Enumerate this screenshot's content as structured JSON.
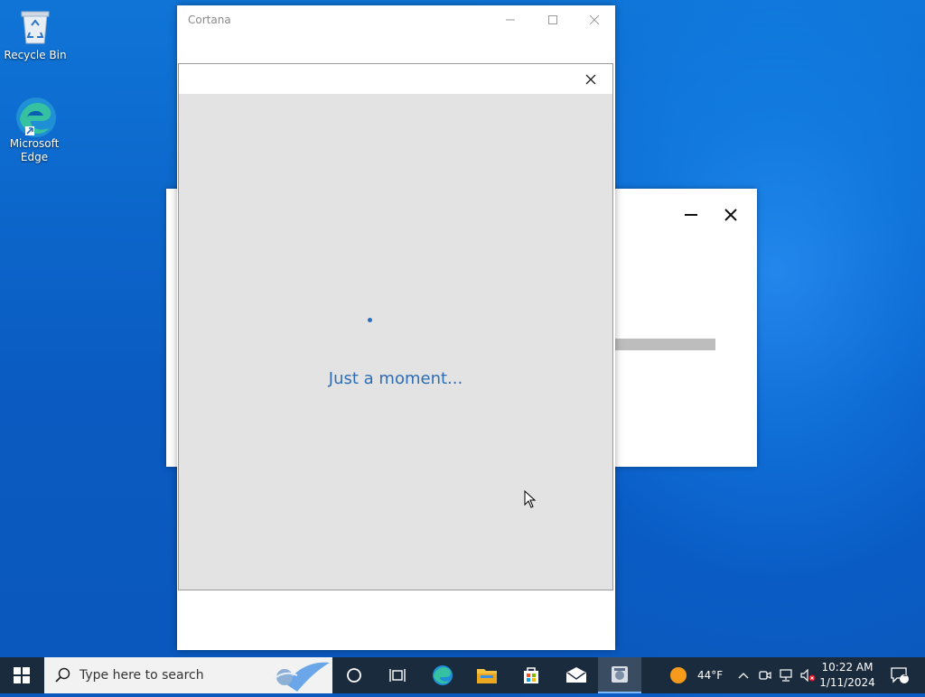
{
  "desktop": {
    "icons": [
      {
        "label": "Recycle Bin",
        "icon": "recycle-bin-icon"
      },
      {
        "label": "Microsoft Edge",
        "icon": "edge-icon"
      }
    ]
  },
  "cortana_window": {
    "title": "Cortana",
    "controls": [
      "minimize",
      "maximize",
      "close"
    ]
  },
  "loading_dialog": {
    "message": "Just a moment..."
  },
  "taskbar": {
    "search_placeholder": "Type here to search",
    "pinned": [
      "cortana-circle-icon",
      "task-view-icon",
      "edge-icon",
      "file-explorer-icon",
      "store-icon",
      "mail-icon",
      "active-app-icon"
    ],
    "weather": {
      "temp": "44°F",
      "icon": "sun-icon"
    },
    "clock": {
      "time": "10:22 AM",
      "date": "1/11/2024"
    },
    "notification_count": "1"
  },
  "colors": {
    "accent": "#2e6db4",
    "taskbar": "#1b2b3e",
    "desktop": "#0a5cc4"
  }
}
